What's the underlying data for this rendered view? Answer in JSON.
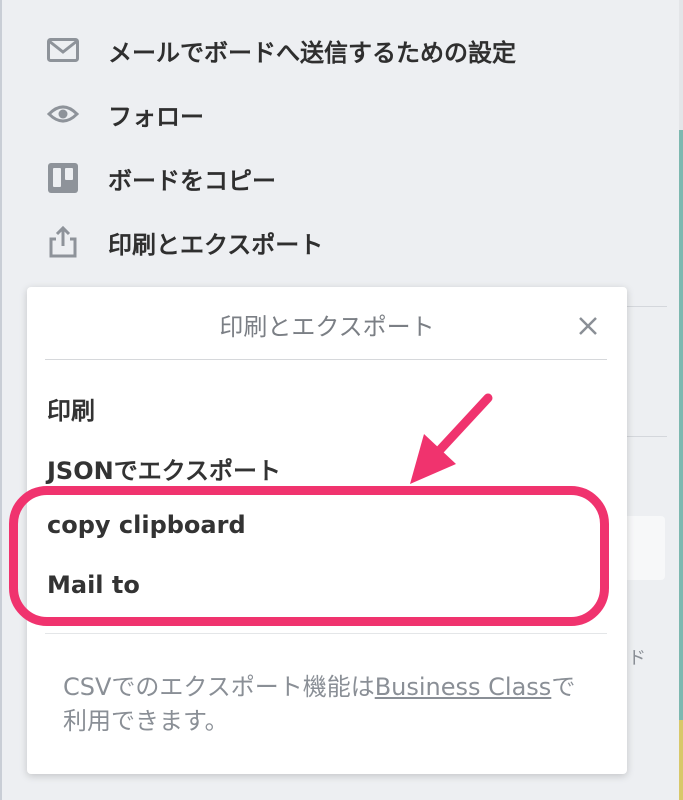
{
  "menu": {
    "items": [
      {
        "icon": "envelope-icon",
        "label": "メールでボードへ送信するための設定"
      },
      {
        "icon": "eye-icon",
        "label": "フォロー"
      },
      {
        "icon": "board-icon",
        "label": "ボードをコピー"
      },
      {
        "icon": "share-upload-icon",
        "label": "印刷とエクスポート"
      }
    ]
  },
  "popover": {
    "title": "印刷とエクスポート",
    "close_icon": "close-icon",
    "items": [
      "印刷",
      "JSONでエクスポート",
      "copy clipboard",
      "Mail to"
    ],
    "note_prefix": "CSVでのエクスポート機能は",
    "note_link": "Business Class",
    "note_suffix": "で利用できます。"
  },
  "background": {
    "fragment": "ド"
  },
  "annotation": {
    "highlight_color": "#f0336e"
  }
}
